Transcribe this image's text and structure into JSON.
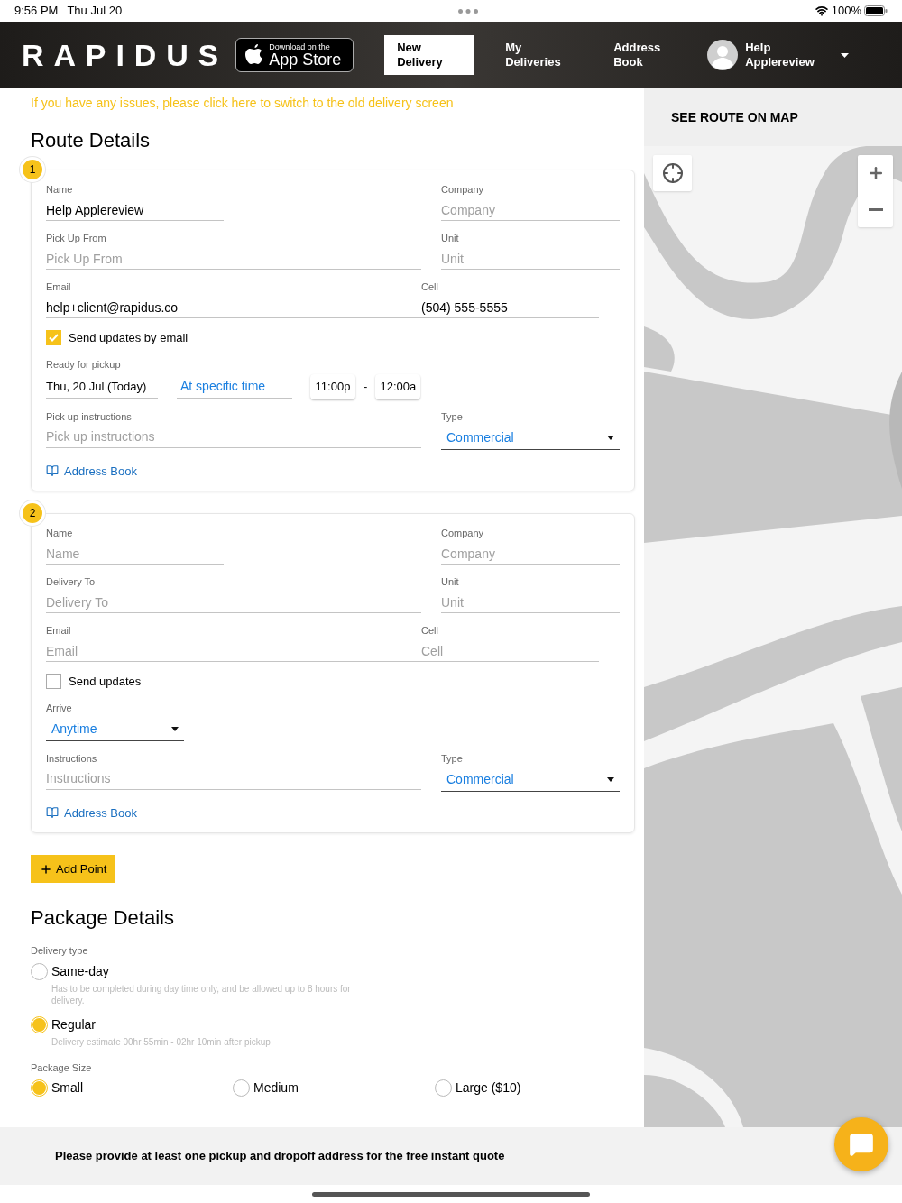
{
  "status_bar": {
    "time": "9:56 PM",
    "date": "Thu Jul 20",
    "battery": "100%"
  },
  "header": {
    "logo": "RAPIDUS",
    "app_store": {
      "top": "Download on the",
      "bottom": "App Store"
    },
    "tabs": [
      {
        "label": "New Delivery",
        "selected": true
      },
      {
        "label": "My Deliveries",
        "selected": false
      },
      {
        "label": "Address Book",
        "selected": false
      }
    ],
    "user": {
      "name": "Help Applereview"
    }
  },
  "notice": "If you have any issues, please click here to switch to the old delivery screen",
  "route_title": "Route Details",
  "stops": [
    {
      "badge": "1",
      "name": {
        "label": "Name",
        "value": "Help Applereview"
      },
      "company": {
        "label": "Company",
        "placeholder": "Company"
      },
      "address": {
        "label": "Pick Up From",
        "placeholder": "Pick Up From"
      },
      "unit": {
        "label": "Unit",
        "placeholder": "Unit"
      },
      "email": {
        "label": "Email",
        "value": "help+client@rapidus.co"
      },
      "cell": {
        "label": "Cell",
        "value": "(504) 555-5555"
      },
      "updates": {
        "label": "Send updates by email",
        "checked": true
      },
      "timing": {
        "kind": "ready",
        "label": "Ready for pickup",
        "date": "Thu, 20 Jul (Today)",
        "mode": "At specific time",
        "start": "11:00p",
        "dash": "-",
        "end": "12:00a"
      },
      "instructions": {
        "label": "Pick up instructions",
        "placeholder": "Pick up instructions"
      },
      "type": {
        "label": "Type",
        "value": "Commercial"
      },
      "address_book": "Address Book"
    },
    {
      "badge": "2",
      "name": {
        "label": "Name",
        "placeholder": "Name"
      },
      "company": {
        "label": "Company",
        "placeholder": "Company"
      },
      "address": {
        "label": "Delivery To",
        "placeholder": "Delivery To"
      },
      "unit": {
        "label": "Unit",
        "placeholder": "Unit"
      },
      "email": {
        "label": "Email",
        "placeholder": "Email"
      },
      "cell": {
        "label": "Cell",
        "placeholder": "Cell"
      },
      "updates": {
        "label": "Send updates",
        "checked": false
      },
      "timing": {
        "kind": "arrive",
        "label": "Arrive",
        "value": "Anytime"
      },
      "instructions": {
        "label": "Instructions",
        "placeholder": "Instructions"
      },
      "type": {
        "label": "Type",
        "value": "Commercial"
      },
      "address_book": "Address Book"
    }
  ],
  "add_point": "Add Point",
  "package_title": "Package Details",
  "delivery_type": {
    "label": "Delivery type",
    "options": [
      {
        "label": "Same-day",
        "note": "Has to be completed during day time only, and be allowed up to 8 hours for delivery.",
        "selected": false
      },
      {
        "label": "Regular",
        "note": "Delivery estimate 00hr 55min - 02hr 10min after pickup",
        "selected": true
      }
    ]
  },
  "package_size": {
    "label": "Package Size",
    "options": [
      {
        "label": "Small",
        "selected": true
      },
      {
        "label": "Medium",
        "selected": false
      },
      {
        "label": "Large ($10)",
        "selected": false
      }
    ]
  },
  "map": {
    "button": "SEE ROUTE ON MAP",
    "kind": "picture"
  },
  "footer": {
    "message": "Please provide at least one pickup and dropoff address for the free instant quote"
  }
}
